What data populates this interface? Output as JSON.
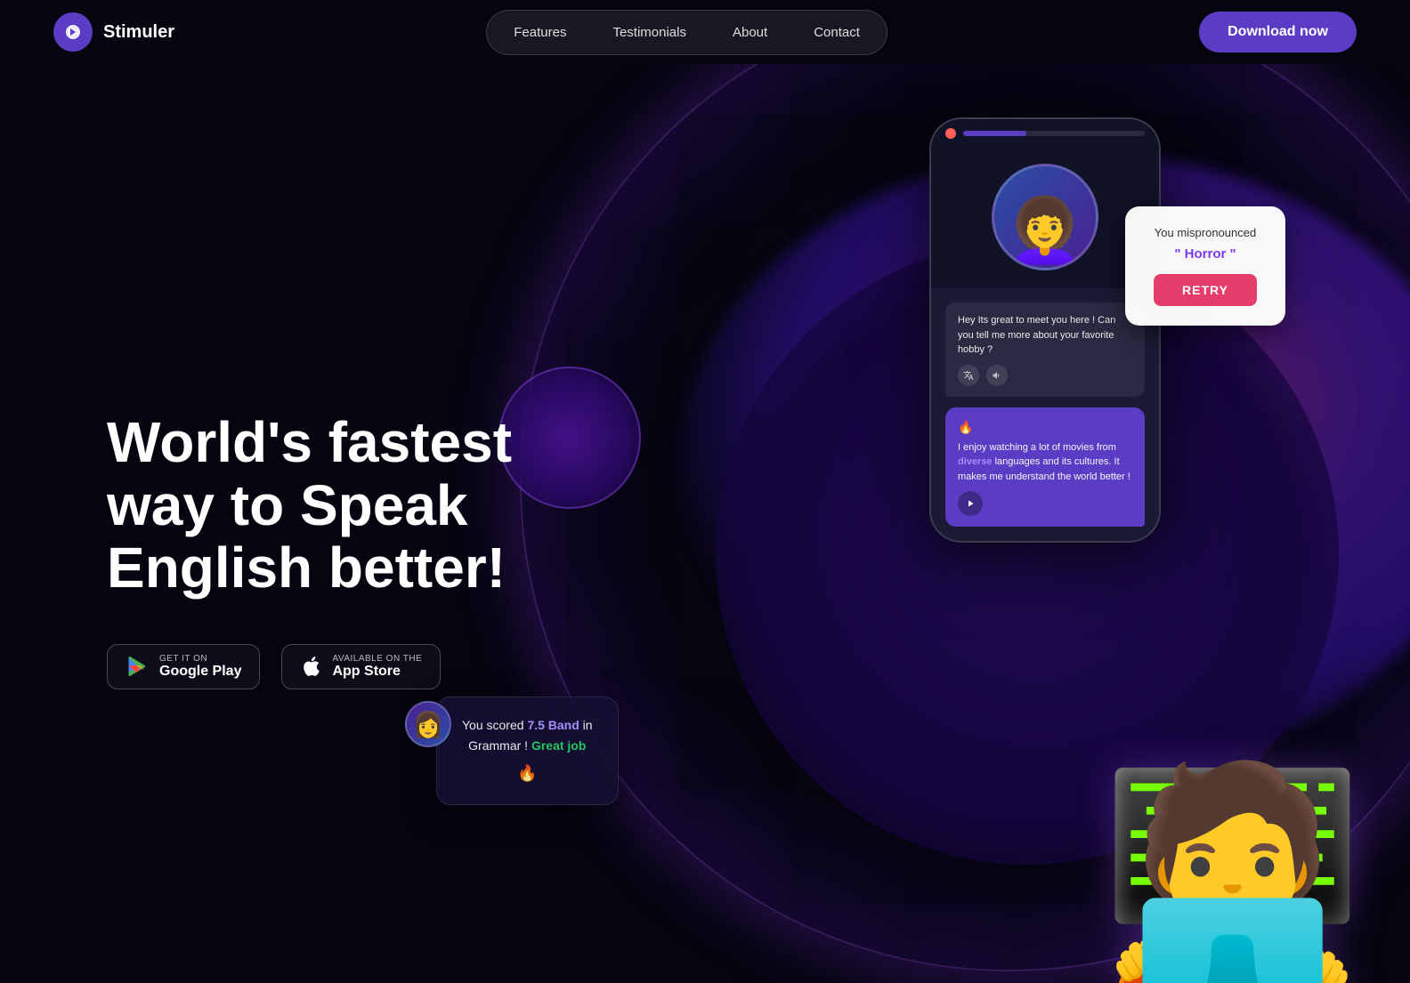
{
  "brand": {
    "name": "Stimuler",
    "logo_icon": "S"
  },
  "navbar": {
    "links": [
      {
        "id": "features",
        "label": "Features"
      },
      {
        "id": "testimonials",
        "label": "Testimonials"
      },
      {
        "id": "about",
        "label": "About"
      },
      {
        "id": "contact",
        "label": "Contact"
      }
    ],
    "cta_label": "Download now"
  },
  "hero": {
    "title_line1": "World's fastest way to Speak",
    "title_line2": "English better!",
    "google_play": {
      "sub": "GET IT ON",
      "main": "Google Play"
    },
    "app_store": {
      "sub": "Available on the",
      "main": "App Store"
    }
  },
  "phone": {
    "chat_message": "Hey Its great to meet you here ! Can you tell me more about your favorite hobby ?",
    "user_reply": "I enjoy watching a lot of movies from diverse languages and its cultures. It makes me understand the world better !",
    "highlight_word": "diverse"
  },
  "score_card": {
    "prefix": "You scored ",
    "band": "7.5 Band",
    "middle": " in",
    "subject": "Grammar !",
    "grade": "Great job"
  },
  "pronunciation_card": {
    "label": "You mispronounced",
    "word_pre": "\" ",
    "word": "Horror",
    "word_post": " \"",
    "retry_label": "RETRY"
  },
  "colors": {
    "primary": "#5b3cc4",
    "accent_pink": "#e53e6d",
    "highlight_purple": "#a78bfa",
    "success_green": "#22c55e"
  }
}
